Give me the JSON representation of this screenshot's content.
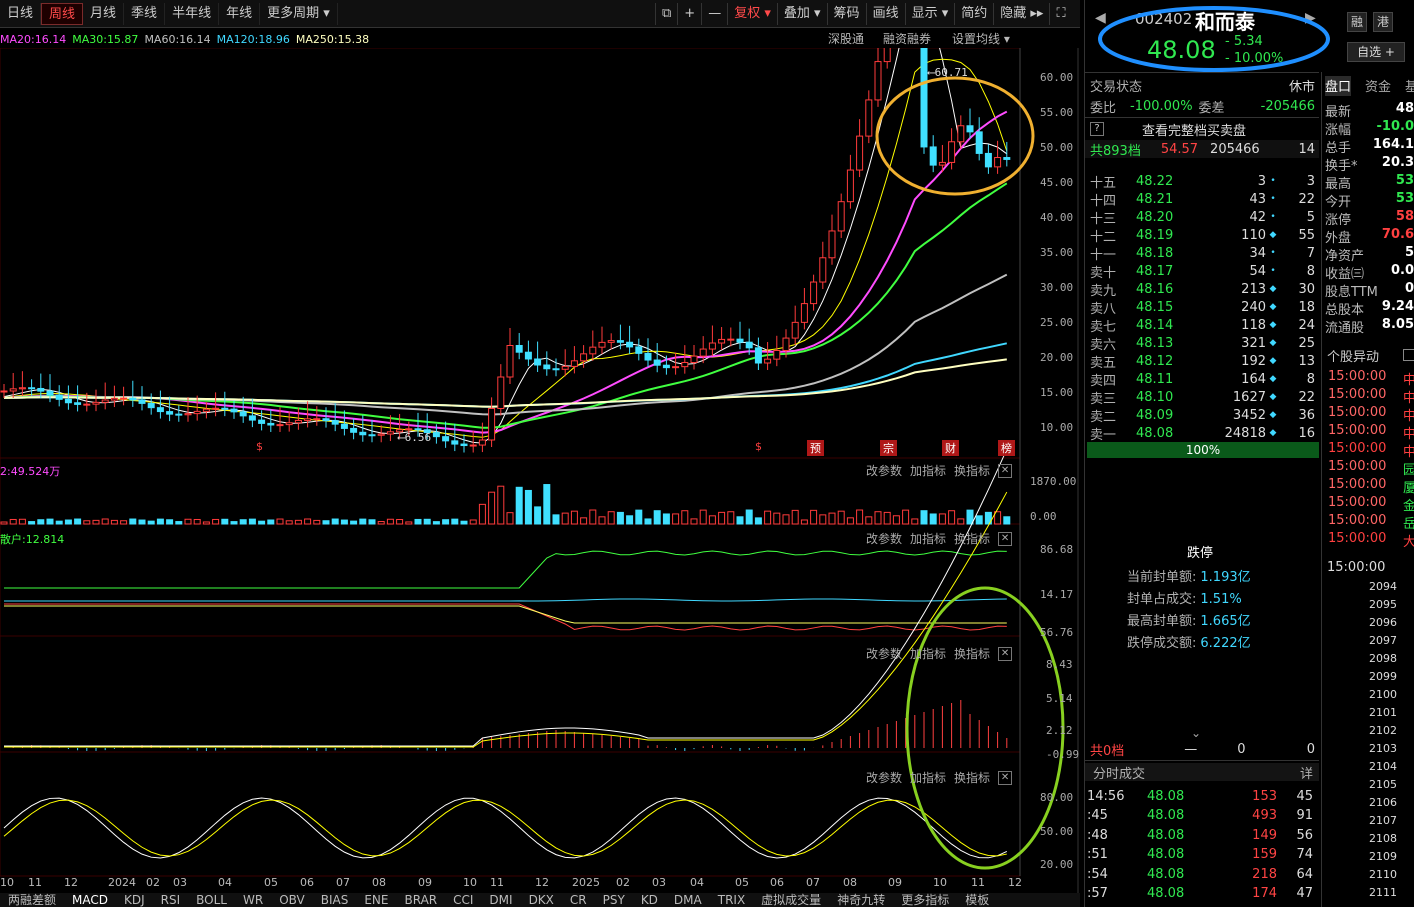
{
  "toolbar": {
    "periods": [
      "日线",
      "周线",
      "月线",
      "季线",
      "半年线",
      "年线",
      "更多周期 ▾"
    ],
    "tools": [
      "⧉",
      "+",
      "—",
      "复权 ▾",
      "叠加 ▾",
      "筹码",
      "画线",
      "显示 ▾",
      "简约",
      "隐藏 ▸▸",
      "⛶"
    ]
  },
  "ma_legend": [
    {
      "label": "MA20:16.14",
      "color": "#ff4cff"
    },
    {
      "label": "MA30:15.87",
      "color": "#40ff40"
    },
    {
      "label": "MA60:16.14",
      "color": "#c0c0c0"
    },
    {
      "label": "MA120:18.96",
      "color": "#40d8ff"
    },
    {
      "label": "MA250:15.38",
      "color": "#ffffc0"
    }
  ],
  "chart_links": [
    "深股通",
    "融资融券",
    "设置均线 ▾"
  ],
  "price_axis": [
    "60.00",
    "55.00",
    "50.00",
    "45.00",
    "40.00",
    "35.00",
    "30.00",
    "25.00",
    "20.00",
    "15.00",
    "10.00"
  ],
  "price_marks": {
    "high": "60.71",
    "low": "6.56"
  },
  "event_tags": [
    "$",
    "$",
    "预",
    "宗",
    "财",
    "榜"
  ],
  "vol": {
    "label": "2:49.524万",
    "axis": [
      "1870.00",
      "0.00"
    ]
  },
  "flow": {
    "label": "散户:12.814",
    "axis": [
      "86.68",
      "14.17",
      "56.76"
    ]
  },
  "macd": {
    "axis": [
      "8.43",
      "5.14",
      "2.12",
      "-0.99"
    ]
  },
  "kdj": {
    "axis": [
      "80.00",
      "50.00",
      "20.00"
    ]
  },
  "panel_controls": [
    "改参数",
    "加指标",
    "换指标",
    "✕"
  ],
  "x_axis": [
    "10",
    "11",
    "12",
    "2024",
    "02",
    "03",
    "04",
    "05",
    "06",
    "07",
    "08",
    "09",
    "10",
    "11",
    "12",
    "2025",
    "02",
    "03",
    "04",
    "05",
    "06",
    "07",
    "08",
    "09",
    "10",
    "11",
    "12"
  ],
  "bottom_tabs": [
    "两融差额",
    "MACD",
    "KDJ",
    "RSI",
    "BOLL",
    "WR",
    "OBV",
    "BIAS",
    "ENE",
    "BRAR",
    "CCI",
    "DMI",
    "DKX",
    "CR",
    "PSY",
    "KD",
    "DMA",
    "TRIX",
    "虚拟成交量",
    "神奇九转",
    "更多指标",
    "模板"
  ],
  "stock": {
    "code": "002402",
    "name": "和而泰",
    "price": "48.08",
    "change": "- 5.34",
    "pct": "- 10.00%",
    "btn_rong": "融",
    "btn_gang": "港",
    "btn_zixuan": "自选 +"
  },
  "quote_header": {
    "trade_status_label": "交易状态",
    "trade_status": "休市",
    "weibi_label": "委比",
    "weibi": "-100.00%",
    "weicha_label": "委差",
    "weicha": "-205466",
    "full_depth": "查看完整档买卖盘",
    "total_label": "共893档",
    "total_price": "54.57",
    "total_vol": "205466",
    "total_cnt": "14"
  },
  "asks": [
    {
      "lv": "十五",
      "p": "48.22",
      "v": "3",
      "c": "3"
    },
    {
      "lv": "十四",
      "p": "48.21",
      "v": "43",
      "c": "22"
    },
    {
      "lv": "十三",
      "p": "48.20",
      "v": "42",
      "c": "5"
    },
    {
      "lv": "十二",
      "p": "48.19",
      "v": "110",
      "c": "55"
    },
    {
      "lv": "十一",
      "p": "48.18",
      "v": "34",
      "c": "7"
    },
    {
      "lv": "卖十",
      "p": "48.17",
      "v": "54",
      "c": "8"
    },
    {
      "lv": "卖九",
      "p": "48.16",
      "v": "213",
      "c": "30"
    },
    {
      "lv": "卖八",
      "p": "48.15",
      "v": "240",
      "c": "18"
    },
    {
      "lv": "卖七",
      "p": "48.14",
      "v": "118",
      "c": "24"
    },
    {
      "lv": "卖六",
      "p": "48.13",
      "v": "321",
      "c": "25"
    },
    {
      "lv": "卖五",
      "p": "48.12",
      "v": "192",
      "c": "13"
    },
    {
      "lv": "卖四",
      "p": "48.11",
      "v": "164",
      "c": "8"
    },
    {
      "lv": "卖三",
      "p": "48.10",
      "v": "1627",
      "c": "22"
    },
    {
      "lv": "卖二",
      "p": "48.09",
      "v": "3452",
      "c": "36"
    },
    {
      "lv": "卖一",
      "p": "48.08",
      "v": "24818",
      "c": "16"
    }
  ],
  "ask_bar_label": "100%",
  "limit_down": {
    "title": "跌停",
    "rows": [
      {
        "k": "当前封单额:",
        "v": "1.193亿"
      },
      {
        "k": "封单占成交:",
        "v": "1.51%"
      },
      {
        "k": "最高封单额:",
        "v": "1.665亿"
      },
      {
        "k": "跌停成交额:",
        "v": "6.222亿"
      }
    ]
  },
  "bid_total": {
    "label": "共0档",
    "a": "—",
    "b": "0",
    "c": "0"
  },
  "ticks_title": "分时成交",
  "ticks_btn": "详",
  "ticks": [
    {
      "t": "14:56",
      "p": "48.08",
      "v": "153",
      "n": "45"
    },
    {
      "t": ":45",
      "p": "48.08",
      "v": "493",
      "n": "91"
    },
    {
      "t": ":48",
      "p": "48.08",
      "v": "149",
      "n": "56"
    },
    {
      "t": ":51",
      "p": "48.08",
      "v": "159",
      "n": "74"
    },
    {
      "t": ":54",
      "p": "48.08",
      "v": "218",
      "n": "64"
    },
    {
      "t": ":57",
      "p": "48.08",
      "v": "174",
      "n": "47"
    }
  ],
  "side_tabs": [
    "盘口",
    "资金",
    "基"
  ],
  "side_stats": [
    {
      "k": "最新",
      "v": "48"
    },
    {
      "k": "涨幅",
      "v": "-10.0"
    },
    {
      "k": "总手",
      "v": "164.1"
    },
    {
      "k": "换手*",
      "v": "20.3"
    },
    {
      "k": "最高",
      "v": "53"
    },
    {
      "k": "今开",
      "v": "53"
    },
    {
      "k": "涨停",
      "v": "58"
    },
    {
      "k": "外盘",
      "v": "70.6"
    },
    {
      "k": "净资产",
      "v": "5"
    },
    {
      "k": "收益㈢",
      "v": "0.0"
    },
    {
      "k": "股息TTM",
      "v": "0"
    },
    {
      "k": "总股本",
      "v": "9.24"
    },
    {
      "k": "流通股",
      "v": "8.05"
    }
  ],
  "anomaly_title": "个股异动",
  "anomaly": [
    "15:00:00",
    "15:00:00",
    "15:00:00",
    "15:00:00",
    "15:00:00",
    "15:00:00",
    "15:00:00",
    "15:00:00",
    "15:00:00",
    "15:00:00"
  ],
  "anomaly_tag": [
    "中",
    "中",
    "中",
    "中",
    "中",
    "园",
    "厦",
    "金",
    "岳",
    "大"
  ],
  "side_time": "15:00:00",
  "side_nums": [
    "2094",
    "2095",
    "2096",
    "2097",
    "2098",
    "2099",
    "2100",
    "2101",
    "2102",
    "2103",
    "2104",
    "2105",
    "2106",
    "2107",
    "2108",
    "2109",
    "2110",
    "2111"
  ]
}
